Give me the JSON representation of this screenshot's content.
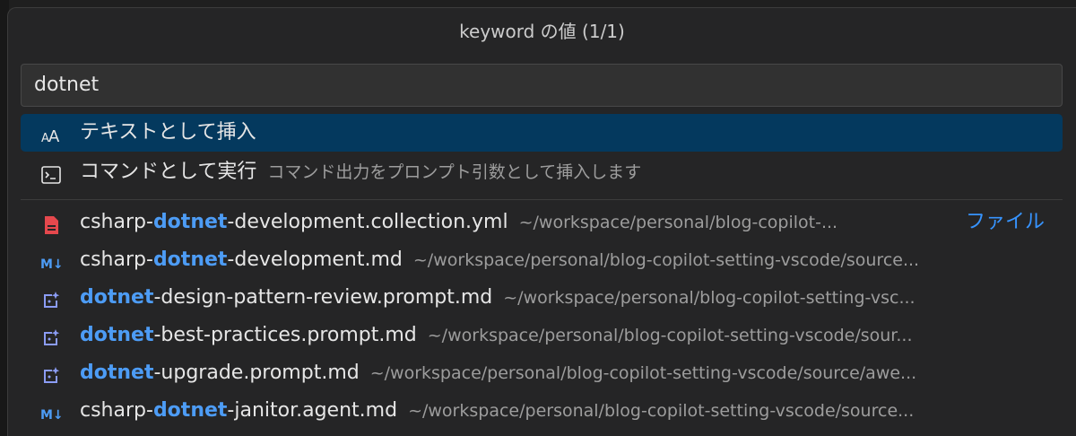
{
  "quickpick": {
    "title": "keyword の値 (1/1)",
    "input_value": "dotnet"
  },
  "actions": [
    {
      "icon": "text-case-icon",
      "label": "テキストとして挿入",
      "desc": ""
    },
    {
      "icon": "terminal-icon",
      "label": "コマンドとして実行",
      "desc": "コマンド出力をプロンプト引数として挿入します"
    }
  ],
  "files": [
    {
      "icon": "yaml-file-icon",
      "prefix": "csharp-",
      "match": "dotnet",
      "suffix": "-development.collection.yml",
      "path": "~/workspace/personal/blog-copilot-...",
      "right": "ファイル"
    },
    {
      "icon": "markdown-icon",
      "prefix": "csharp-",
      "match": "dotnet",
      "suffix": "-development.md",
      "path": "~/workspace/personal/blog-copilot-setting-vscode/source..."
    },
    {
      "icon": "prompt-sparkle-icon",
      "prefix": "",
      "match": "dotnet",
      "suffix": "-design-pattern-review.prompt.md",
      "path": "~/workspace/personal/blog-copilot-setting-vsc..."
    },
    {
      "icon": "prompt-sparkle-icon",
      "prefix": "",
      "match": "dotnet",
      "suffix": "-best-practices.prompt.md",
      "path": "~/workspace/personal/blog-copilot-setting-vscode/sour..."
    },
    {
      "icon": "prompt-sparkle-icon",
      "prefix": "",
      "match": "dotnet",
      "suffix": "-upgrade.prompt.md",
      "path": "~/workspace/personal/blog-copilot-setting-vscode/source/awe..."
    },
    {
      "icon": "markdown-icon",
      "prefix": "csharp-",
      "match": "dotnet",
      "suffix": "-janitor.agent.md",
      "path": "~/workspace/personal/blog-copilot-setting-vscode/source..."
    }
  ],
  "colors": {
    "selection": "#04395e",
    "match_highlight": "#4d9cf5",
    "file_badge": "#3794ff",
    "yaml_icon": "#e5484d",
    "prompt_icon": "#8b9cf4"
  }
}
